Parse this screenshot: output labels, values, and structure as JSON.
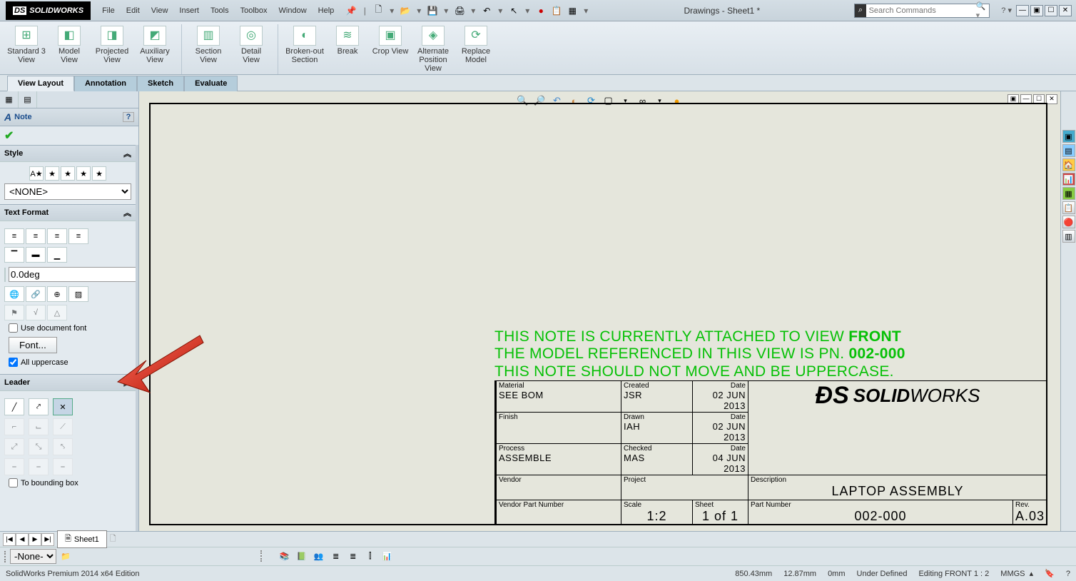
{
  "app": {
    "name": "SOLIDWORKS",
    "title": "Drawings - Sheet1 *",
    "edition": "SolidWorks Premium 2014 x64 Edition"
  },
  "menu": [
    "File",
    "Edit",
    "View",
    "Insert",
    "Tools",
    "Toolbox",
    "Window",
    "Help"
  ],
  "search": {
    "placeholder": "Search Commands"
  },
  "ribbon": {
    "groups": [
      {
        "buttons": [
          {
            "label": "Standard 3 View",
            "icon": "⊞"
          },
          {
            "label": "Model View",
            "icon": "◧"
          },
          {
            "label": "Projected View",
            "icon": "◨"
          },
          {
            "label": "Auxiliary View",
            "icon": "◩"
          }
        ]
      },
      {
        "buttons": [
          {
            "label": "Section View",
            "icon": "▥"
          },
          {
            "label": "Detail View",
            "icon": "◎"
          }
        ]
      },
      {
        "buttons": [
          {
            "label": "Broken-out Section",
            "icon": "◐"
          },
          {
            "label": "Break",
            "icon": "≋"
          },
          {
            "label": "Crop View",
            "icon": "▣"
          },
          {
            "label": "Alternate Position View",
            "icon": "◈"
          },
          {
            "label": "Replace Model",
            "icon": "⟳"
          }
        ]
      }
    ]
  },
  "cm_tabs": [
    "View Layout",
    "Annotation",
    "Sketch",
    "Evaluate"
  ],
  "cm_active": 0,
  "prop": {
    "title": "Note",
    "style": {
      "header": "Style",
      "value": "<NONE>"
    },
    "textformat": {
      "header": "Text Format",
      "angle": "0.0deg",
      "use_doc_font": "Use document font",
      "font_btn": "Font...",
      "all_upper": "All uppercase"
    },
    "leader": {
      "header": "Leader",
      "to_bbox": "To bounding box"
    }
  },
  "canvas": {
    "note_line1a": "THIS NOTE IS CURRENTLY ATTACHED TO VIEW ",
    "note_line1b": "FRONT",
    "note_line2a": "THE MODEL REFERENCED IN THIS VIEW IS PN. ",
    "note_line2b": "002-000",
    "note_line3": "THIS NOTE SHOULD NOT MOVE AND BE UPPERCASE."
  },
  "titleblock": {
    "material_lbl": "Material",
    "material": "SEE BOM",
    "created_lbl": "Created",
    "created_by": "JSR",
    "created_date": "02 JUN 2013",
    "finish_lbl": "Finish",
    "finish": "",
    "drawn_lbl": "Drawn",
    "drawn_by": "IAH",
    "drawn_date": "02 JUN 2013",
    "process_lbl": "Process",
    "process": "ASSEMBLE",
    "checked_lbl": "Checked",
    "checked_by": "MAS",
    "checked_date": "04 JUN 2013",
    "vendor_lbl": "Vendor",
    "vendor": "",
    "project_lbl": "Project",
    "project": "",
    "desc_lbl": "Description",
    "desc": "LAPTOP ASSEMBLY",
    "vpn_lbl": "Vendor Part Number",
    "vpn": "",
    "scale_lbl": "Scale",
    "scale": "1:2",
    "sheet_lbl": "Sheet",
    "sheet": "1 of 1",
    "pn_lbl": "Part Number",
    "pn": "002-000",
    "rev_lbl": "Rev.",
    "rev": "A.03",
    "date_lbl": "Date",
    "logo_thin": "WORKS",
    "logo_bold": "SOLID"
  },
  "sheet_tab": "Sheet1",
  "filter": {
    "value": "-None-"
  },
  "status": {
    "x": "850.43mm",
    "y": "12.87mm",
    "z": "0mm",
    "state": "Under Defined",
    "edit": "Editing FRONT  1 : 2",
    "units": "MMGS"
  }
}
